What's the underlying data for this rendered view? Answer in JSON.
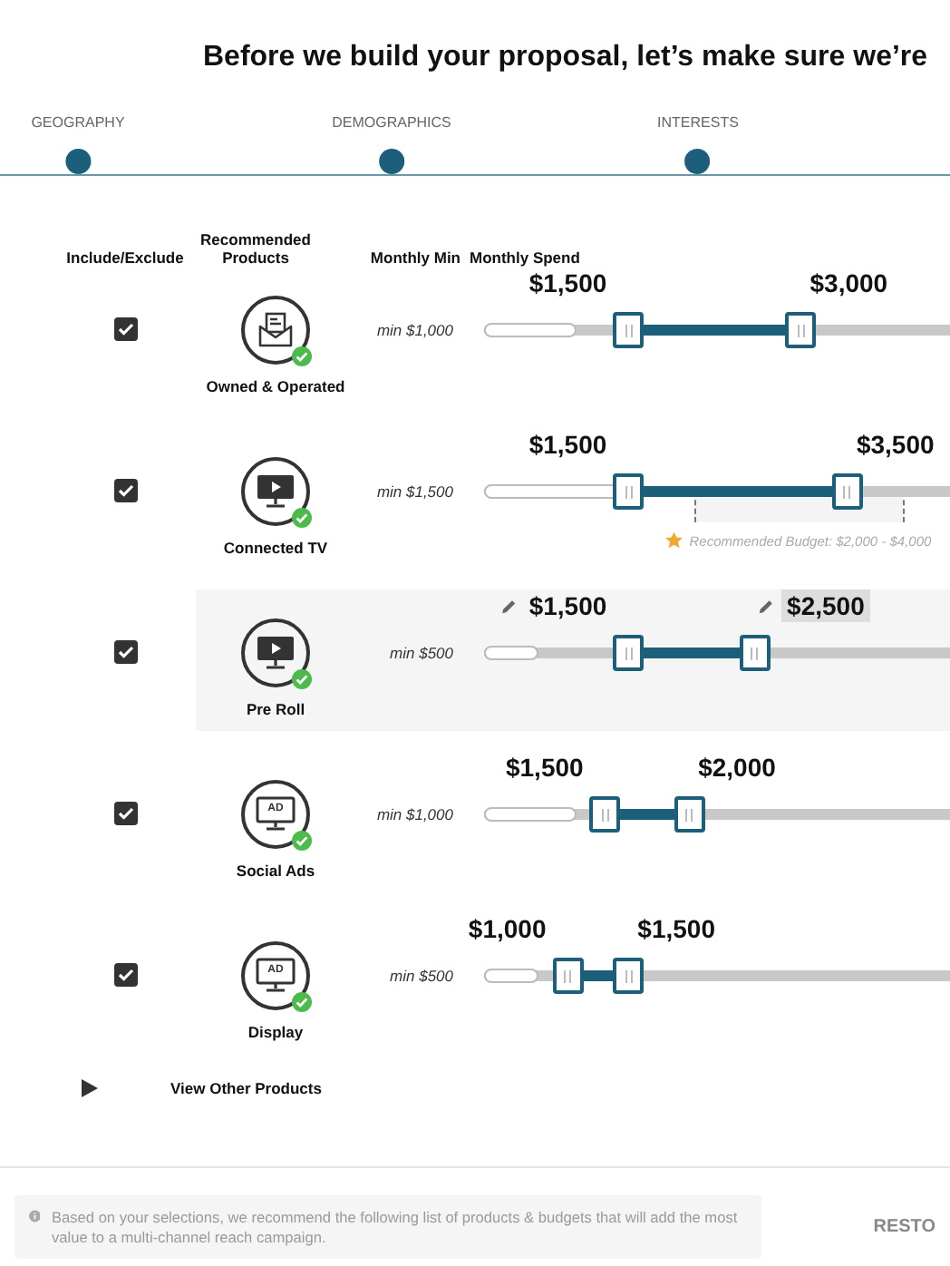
{
  "title": "Before we build your proposal, let’s make sure we’re",
  "steps": [
    {
      "label": "GEOGRAPHY"
    },
    {
      "label": "DEMOGRAPHICS"
    },
    {
      "label": "INTERESTS"
    }
  ],
  "table": {
    "columns": [
      "Include/Exclude",
      "Recommended Products",
      "Monthly Min",
      "Monthly Spend"
    ],
    "rows": [
      {
        "checked": true,
        "highlighted": false,
        "product": "Owned & Operated",
        "kind": "mail",
        "min": {
          "text": "min $1,000",
          "level": 0.19
        },
        "range": {
          "start": {
            "level": 0.31
          },
          "end": {
            "level": 0.68
          }
        },
        "values": [
          {
            "text": "$1,500",
            "editable": false,
            "selected": false
          },
          {
            "text": "$3,000",
            "editable": false,
            "selected": false
          }
        ]
      },
      {
        "checked": true,
        "highlighted": false,
        "product": "Connected TV",
        "kind": "tv",
        "min": {
          "text": "min $1,500",
          "level": 0.29
        },
        "range": {
          "start": {
            "level": 0.31
          },
          "end": {
            "level": 0.78
          }
        },
        "values": [
          {
            "text": "$1,500",
            "editable": false,
            "selected": false
          },
          {
            "text": "$3,500",
            "editable": false,
            "selected": false
          }
        ],
        "recommended": {
          "text": "Recommended Budget: $2,000 - $4,000",
          "start": {
            "level": 0.45
          },
          "end": {
            "level": 0.9
          }
        }
      },
      {
        "checked": true,
        "highlighted": true,
        "product": "Pre Roll",
        "kind": "tv",
        "min": {
          "text": "min $500",
          "level": 0.11
        },
        "range": {
          "start": {
            "level": 0.31
          },
          "end": {
            "level": 0.58
          }
        },
        "values": [
          {
            "text": "$1,500",
            "editable": true,
            "selected": false
          },
          {
            "text": "$2,500",
            "editable": true,
            "selected": true
          }
        ]
      },
      {
        "checked": true,
        "highlighted": false,
        "product": "Social Ads",
        "kind": "ad",
        "icon_text": "AD",
        "min": {
          "text": "min $1,000",
          "level": 0.19
        },
        "range": {
          "start": {
            "level": 0.26
          },
          "end": {
            "level": 0.44
          }
        },
        "values": [
          {
            "text": "$1,500",
            "editable": false,
            "selected": false
          },
          {
            "text": "$2,000",
            "editable": false,
            "selected": false
          }
        ]
      },
      {
        "checked": true,
        "highlighted": false,
        "product": "Display",
        "kind": "ad",
        "icon_text": "AD",
        "min": {
          "text": "min $500",
          "level": 0.11
        },
        "range": {
          "start": {
            "level": 0.18
          },
          "end": {
            "level": 0.31
          }
        },
        "values": [
          {
            "text": "$1,000",
            "editable": false,
            "selected": false
          },
          {
            "text": "$1,500",
            "editable": false,
            "selected": false
          }
        ]
      }
    ]
  },
  "view_other": {
    "label": "View Other Products",
    "expanded": false
  },
  "info": "Based on your selections, we recommend the following list of products & budgets that will add the most value to a multi-channel reach campaign.",
  "restore_button": "RESTO"
}
